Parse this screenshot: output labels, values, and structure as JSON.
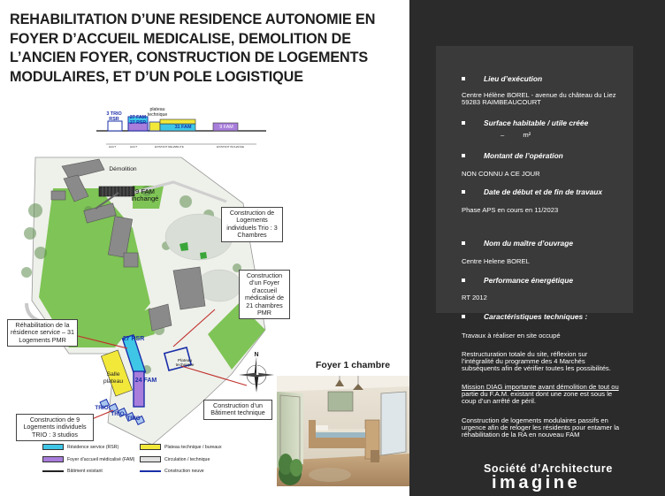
{
  "title_lines": [
    "REHABILITATION D’UNE RESIDENCE AUTONOMIE EN",
    "FOYER D’ACCUEIL MEDICALISE, DEMOLITION DE",
    "L’ANCIEN FOYER, CONSTRUCTION DE LOGEMENTS",
    "MODULAIRES, ET D’UN POLE LOGISTIQUE"
  ],
  "section_diagram": {
    "trio_label": "3 TRIO RSR",
    "rsr_label": "27 FAM 27 RSR",
    "plateau_label": "plateau technique",
    "fam31_label": "31 FAM",
    "fam9_label": "9 FAM"
  },
  "plan_labels": {
    "demolition": "Démolition",
    "fam9": "9 FAM inchangé",
    "trio_construction": "Construction de Logements individuels Trio : 3 Chambres",
    "foyer_construction": "Construction d’un Foyer d’accueil médicalisé de 21 chambres PMR",
    "rehab": "Réhabilitation de la résidence service – 31 Logements PMR",
    "rsr27": "27 RSR",
    "salle": "Salle plateau",
    "fam24": "24 FAM",
    "plateau_tech": "Plateau technique",
    "batiment": "Construction d’un Bâtiment technique",
    "logements9": "Construction de 9 Logements individuels TRIO : 3 studios",
    "trio": "TRIO",
    "north": "N"
  },
  "legend": {
    "rsr": "Résidence service (RSR)",
    "fam": "Foyer d’accueil médicalisé (FAM)",
    "existing": "Bâtiment existant",
    "plateau": "Plateau technique / bureaux",
    "circulation": "Circulation / technique",
    "new": "Construction neuve"
  },
  "render_title": "Foyer 1 chambre",
  "sections": [
    {
      "heading": "Lieu d’exécution",
      "lines": [
        "Centre Hélène BOREL - avenue du château du Liez",
        "59283 RAIMBEAUCOURT"
      ]
    },
    {
      "heading": "Surface habitable / utile créée",
      "lines": [
        "–          m²"
      ]
    },
    {
      "heading": "Montant de l’opération",
      "lines": [
        "NON CONNU A CE JOUR"
      ]
    },
    {
      "heading": "Date de début et de fin de travaux",
      "lines": [
        "Phase APS en cours en 11/2023"
      ]
    },
    {
      "heading": "Nom du maître d’ouvrage",
      "lines": [
        "Centre Helene BOREL"
      ]
    },
    {
      "heading": "Performance énergétique",
      "lines": [
        "RT 2012"
      ]
    },
    {
      "heading": "Caractéristiques techniques :",
      "lines": []
    }
  ],
  "tech_paragraphs": [
    [
      "Travaux à réaliser en site occupé"
    ],
    [
      "Restructuration totale du site, réflexion sur",
      "l’intégralité du programme des 4 Marchés",
      "subséquents afin de vérifier toutes les possibilités."
    ],
    [
      "Mission DIAG importante avant démolition de tout ou",
      "partie du F.A.M. existant dont une zone est sous le",
      "coup d’un arrêté de péril."
    ],
    [
      "Construction de logements modulaires passifs en",
      "urgence afin de reloger les résidents pour entamer la",
      "réhabilitation de la RA en nouveau FAM"
    ]
  ],
  "logo": {
    "line1": "Société d’Architecture",
    "line2": "imagine"
  },
  "colors": {
    "panel_bg": "#2b2b2b",
    "card_bg": "#3a3a3a",
    "rsr_cyan": "#3fc6e6",
    "fam_violet": "#a87ddb",
    "plateau_yellow": "#f2e83a",
    "green": "#7fc456",
    "new_blue": "#1a2fa8"
  }
}
